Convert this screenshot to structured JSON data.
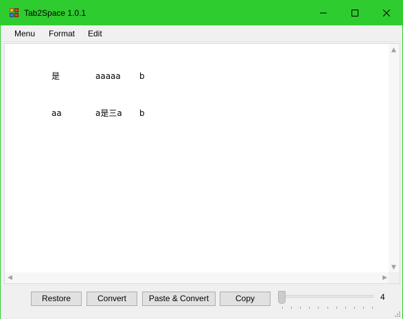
{
  "window": {
    "title": "Tab2Space  1.0.1",
    "accent_color": "#2ecc2e",
    "icons": {
      "app": "app-icon",
      "minimize": "minimize-icon",
      "maximize": "maximize-icon",
      "close": "close-icon"
    }
  },
  "menu": {
    "items": [
      {
        "label": "Menu"
      },
      {
        "label": "Format"
      },
      {
        "label": "Edit"
      }
    ]
  },
  "editor": {
    "lines": [
      {
        "cells": [
          "是",
          "aaaaa",
          "b"
        ]
      },
      {
        "cells": [
          "aa",
          "a是三a",
          "b"
        ]
      }
    ]
  },
  "buttons": {
    "restore": "Restore",
    "convert": "Convert",
    "paste_convert": "Paste & Convert",
    "copy": "Copy"
  },
  "tab_width": {
    "value": "4",
    "slider_fraction": 0
  }
}
